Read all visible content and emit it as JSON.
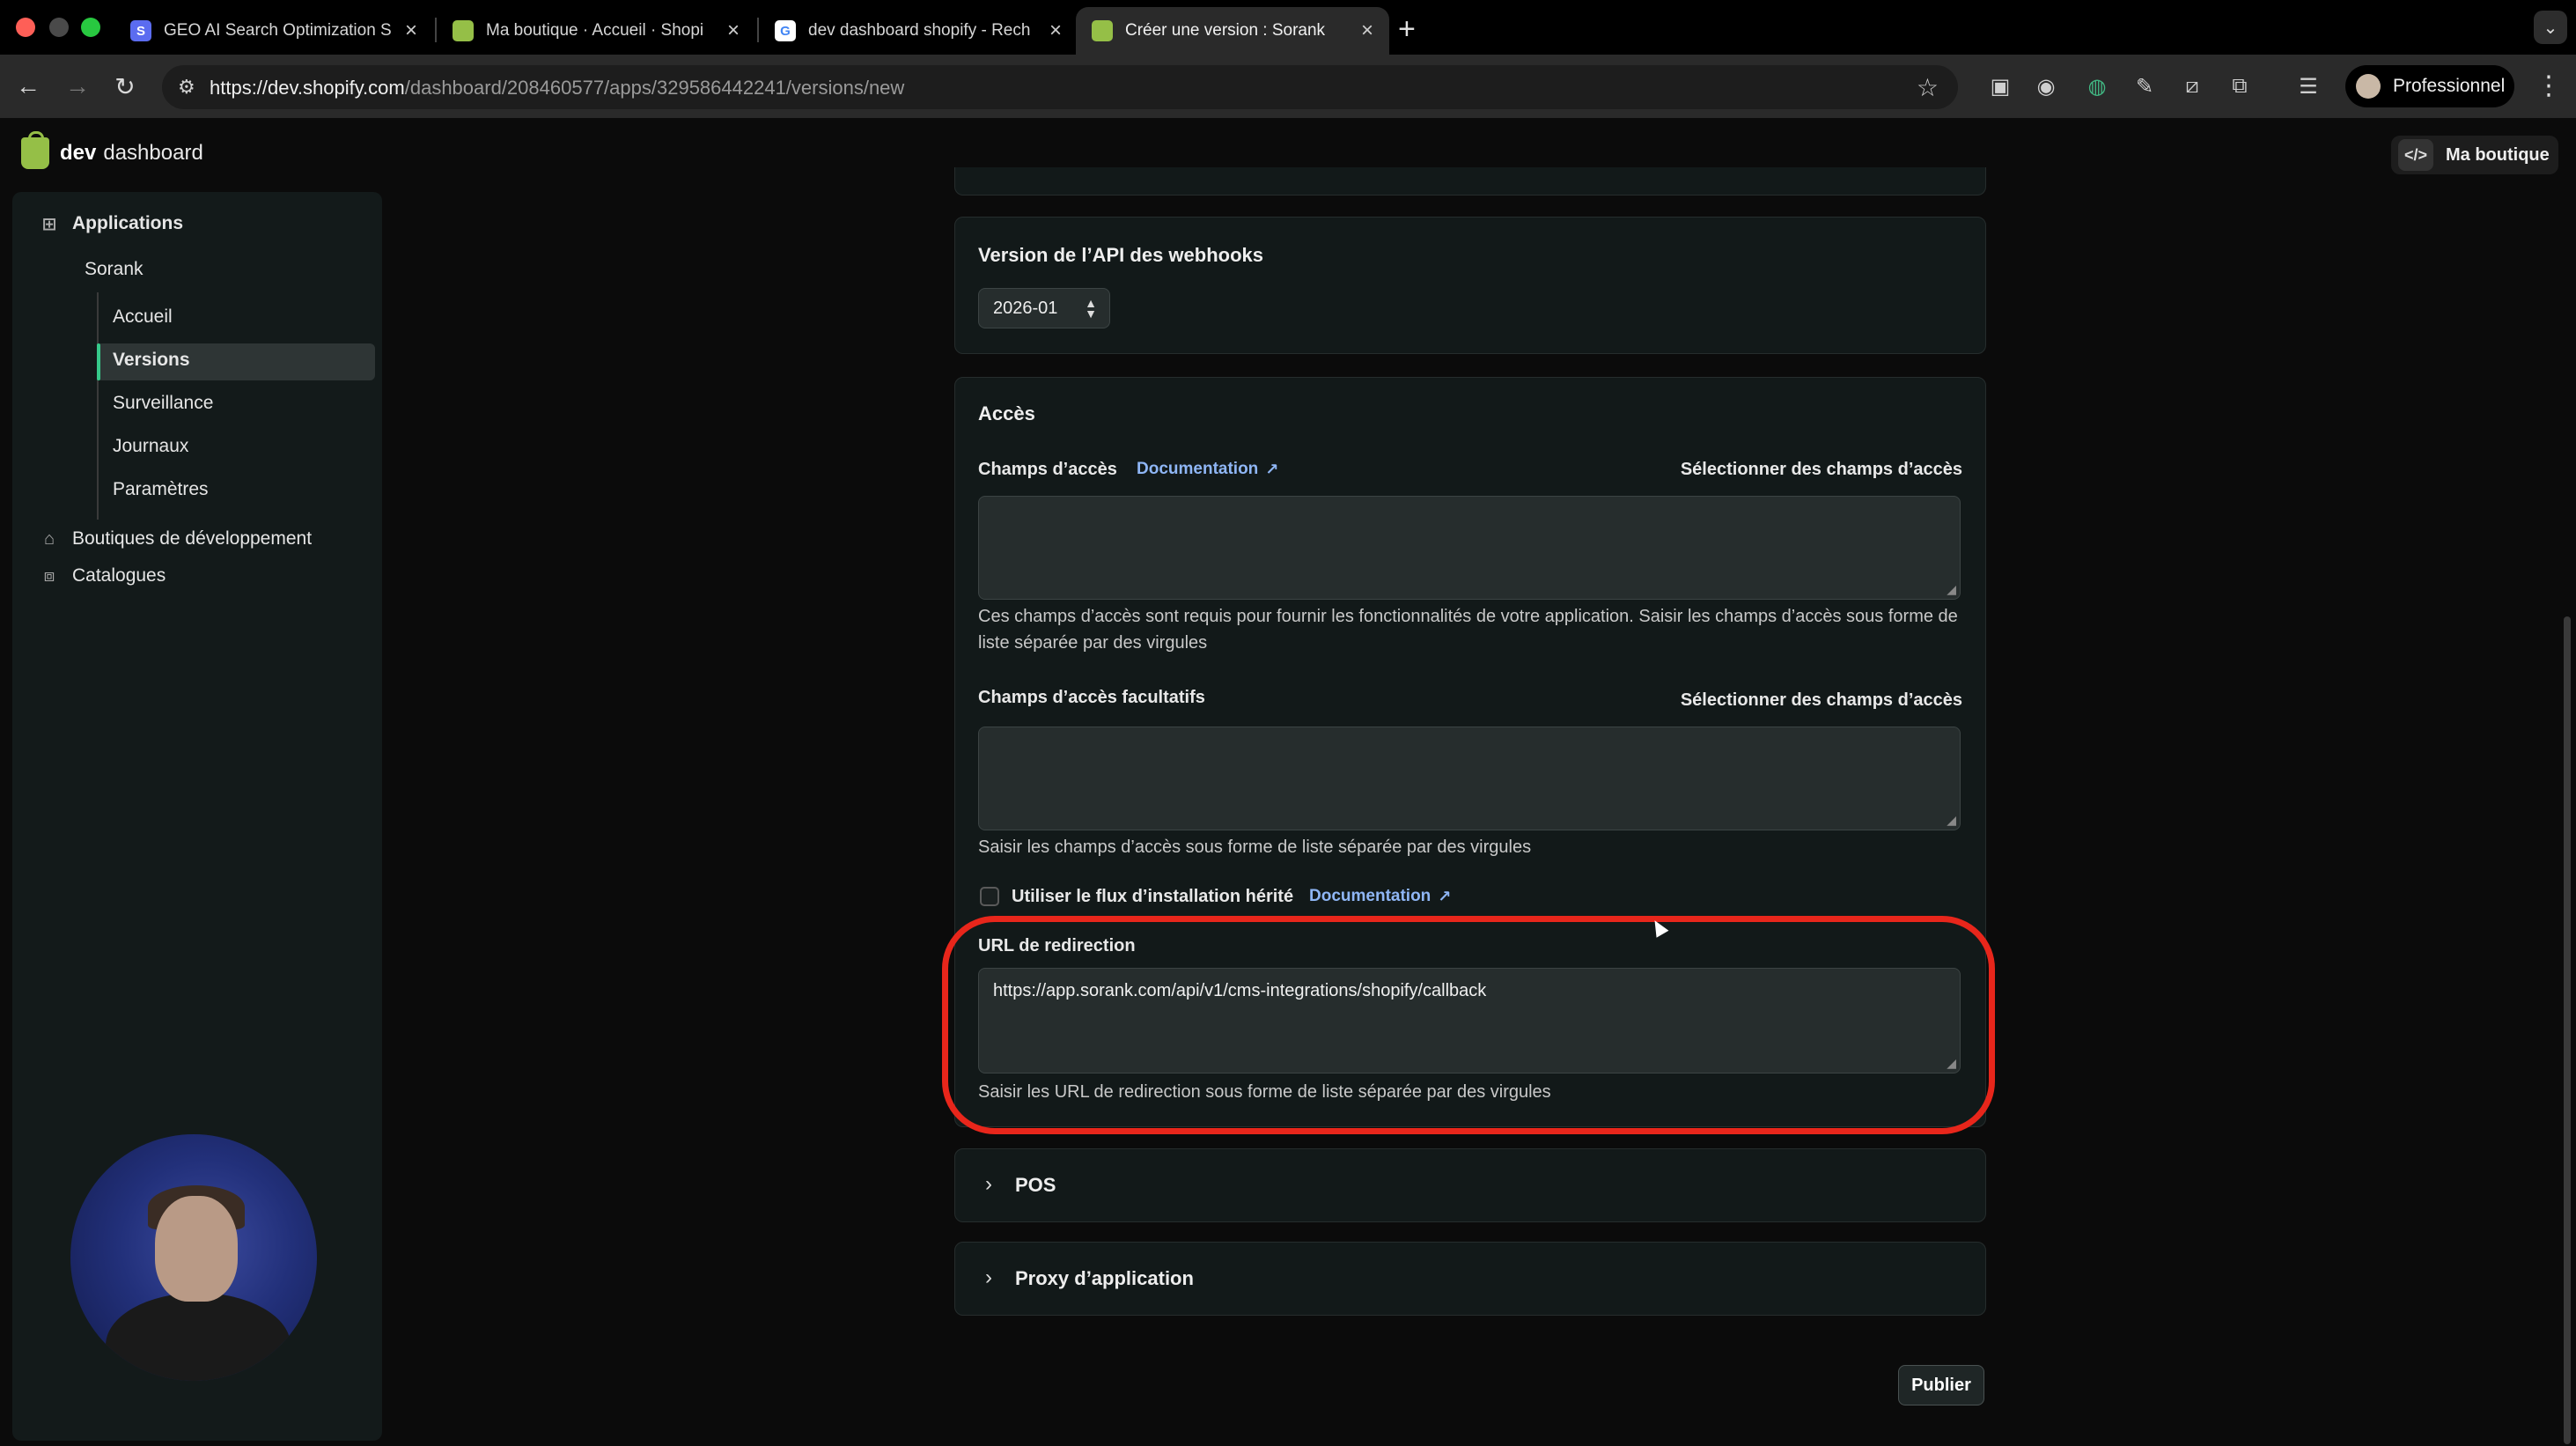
{
  "browser": {
    "tabs": [
      {
        "title": "GEO AI Search Optimization S",
        "favicon": "S",
        "favicon_color": "#5b6cf0"
      },
      {
        "title": "Ma boutique · Accueil · Shopi",
        "favicon": "",
        "favicon_color": "#95bf47"
      },
      {
        "title": "dev dashboard shopify - Rech",
        "favicon": "G",
        "favicon_color": "#4285f4"
      },
      {
        "title": "Créer une version : Sorank",
        "favicon": "",
        "favicon_color": "#95bf47"
      }
    ],
    "url_host": "https://dev.shopify.com",
    "url_path": "/dashboard/208460577/apps/329586442241/versions/new",
    "profile_label": "Professionnel"
  },
  "header": {
    "brand_bold": "dev",
    "brand_rest": "dashboard",
    "store_button": "Ma boutique"
  },
  "sidebar": {
    "applications": "Applications",
    "app_name": "Sorank",
    "items": [
      "Accueil",
      "Versions",
      "Surveillance",
      "Journaux",
      "Paramètres"
    ],
    "active_item": "Versions",
    "dev_stores": "Boutiques de développement",
    "catalogs": "Catalogues"
  },
  "webhooks": {
    "title": "Version de l’API des webhooks",
    "version": "2026-01"
  },
  "access": {
    "title": "Accès",
    "scopes_label": "Champs d’accès",
    "doc_label": "Documentation",
    "select_label": "Sélectionner des champs d’accès",
    "scopes_value": "",
    "scopes_help": "Ces champs d’accès sont requis pour fournir les fonctionnalités de votre application. Saisir les champs d’accès sous forme de liste séparée par des virgules",
    "optional_label": "Champs d’accès facultatifs",
    "optional_select_label": "Sélectionner des champs d’accès",
    "optional_value": "",
    "optional_help": "Saisir les champs d’accès sous forme de liste séparée par des virgules",
    "legacy_label": "Utiliser le flux d’installation hérité",
    "legacy_doc": "Documentation",
    "legacy_checked": false,
    "redirect_label": "URL de redirection",
    "redirect_value": "https://app.sorank.com/api/v1/cms-integrations/shopify/callback",
    "redirect_help": "Saisir les URL de redirection sous forme de liste séparée par des virgules"
  },
  "sections": {
    "pos": "POS",
    "proxy": "Proxy d’application"
  },
  "publish_label": "Publier",
  "colors": {
    "accent": "#36c98a",
    "highlight": "#e8261b",
    "link": "#8fb6f5"
  }
}
